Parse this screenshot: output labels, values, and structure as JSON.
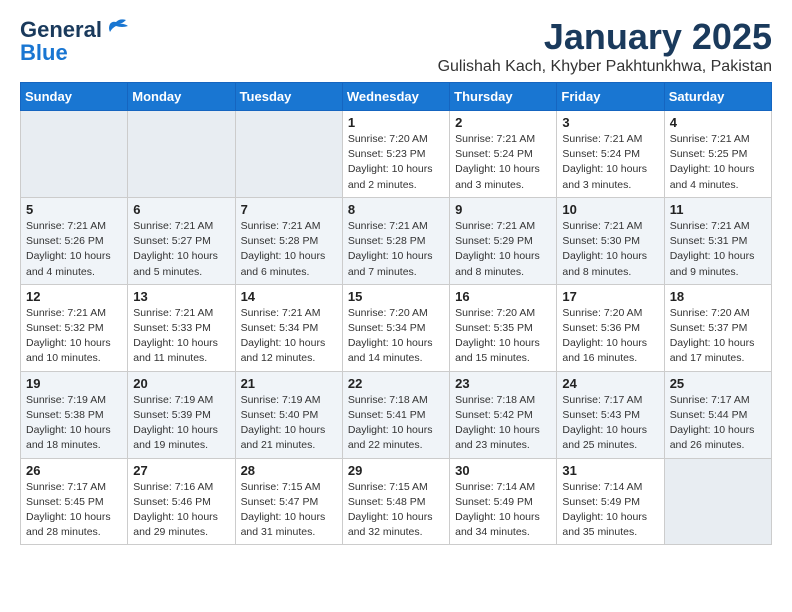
{
  "header": {
    "logo_line1": "General",
    "logo_line2": "Blue",
    "main_title": "January 2025",
    "subtitle": "Gulishah Kach, Khyber Pakhtunkhwa, Pakistan"
  },
  "calendar": {
    "days_of_week": [
      "Sunday",
      "Monday",
      "Tuesday",
      "Wednesday",
      "Thursday",
      "Friday",
      "Saturday"
    ],
    "weeks": [
      [
        {
          "day": "",
          "info": ""
        },
        {
          "day": "",
          "info": ""
        },
        {
          "day": "",
          "info": ""
        },
        {
          "day": "1",
          "info": "Sunrise: 7:20 AM\nSunset: 5:23 PM\nDaylight: 10 hours\nand 2 minutes."
        },
        {
          "day": "2",
          "info": "Sunrise: 7:21 AM\nSunset: 5:24 PM\nDaylight: 10 hours\nand 3 minutes."
        },
        {
          "day": "3",
          "info": "Sunrise: 7:21 AM\nSunset: 5:24 PM\nDaylight: 10 hours\nand 3 minutes."
        },
        {
          "day": "4",
          "info": "Sunrise: 7:21 AM\nSunset: 5:25 PM\nDaylight: 10 hours\nand 4 minutes."
        }
      ],
      [
        {
          "day": "5",
          "info": "Sunrise: 7:21 AM\nSunset: 5:26 PM\nDaylight: 10 hours\nand 4 minutes."
        },
        {
          "day": "6",
          "info": "Sunrise: 7:21 AM\nSunset: 5:27 PM\nDaylight: 10 hours\nand 5 minutes."
        },
        {
          "day": "7",
          "info": "Sunrise: 7:21 AM\nSunset: 5:28 PM\nDaylight: 10 hours\nand 6 minutes."
        },
        {
          "day": "8",
          "info": "Sunrise: 7:21 AM\nSunset: 5:28 PM\nDaylight: 10 hours\nand 7 minutes."
        },
        {
          "day": "9",
          "info": "Sunrise: 7:21 AM\nSunset: 5:29 PM\nDaylight: 10 hours\nand 8 minutes."
        },
        {
          "day": "10",
          "info": "Sunrise: 7:21 AM\nSunset: 5:30 PM\nDaylight: 10 hours\nand 8 minutes."
        },
        {
          "day": "11",
          "info": "Sunrise: 7:21 AM\nSunset: 5:31 PM\nDaylight: 10 hours\nand 9 minutes."
        }
      ],
      [
        {
          "day": "12",
          "info": "Sunrise: 7:21 AM\nSunset: 5:32 PM\nDaylight: 10 hours\nand 10 minutes."
        },
        {
          "day": "13",
          "info": "Sunrise: 7:21 AM\nSunset: 5:33 PM\nDaylight: 10 hours\nand 11 minutes."
        },
        {
          "day": "14",
          "info": "Sunrise: 7:21 AM\nSunset: 5:34 PM\nDaylight: 10 hours\nand 12 minutes."
        },
        {
          "day": "15",
          "info": "Sunrise: 7:20 AM\nSunset: 5:34 PM\nDaylight: 10 hours\nand 14 minutes."
        },
        {
          "day": "16",
          "info": "Sunrise: 7:20 AM\nSunset: 5:35 PM\nDaylight: 10 hours\nand 15 minutes."
        },
        {
          "day": "17",
          "info": "Sunrise: 7:20 AM\nSunset: 5:36 PM\nDaylight: 10 hours\nand 16 minutes."
        },
        {
          "day": "18",
          "info": "Sunrise: 7:20 AM\nSunset: 5:37 PM\nDaylight: 10 hours\nand 17 minutes."
        }
      ],
      [
        {
          "day": "19",
          "info": "Sunrise: 7:19 AM\nSunset: 5:38 PM\nDaylight: 10 hours\nand 18 minutes."
        },
        {
          "day": "20",
          "info": "Sunrise: 7:19 AM\nSunset: 5:39 PM\nDaylight: 10 hours\nand 19 minutes."
        },
        {
          "day": "21",
          "info": "Sunrise: 7:19 AM\nSunset: 5:40 PM\nDaylight: 10 hours\nand 21 minutes."
        },
        {
          "day": "22",
          "info": "Sunrise: 7:18 AM\nSunset: 5:41 PM\nDaylight: 10 hours\nand 22 minutes."
        },
        {
          "day": "23",
          "info": "Sunrise: 7:18 AM\nSunset: 5:42 PM\nDaylight: 10 hours\nand 23 minutes."
        },
        {
          "day": "24",
          "info": "Sunrise: 7:17 AM\nSunset: 5:43 PM\nDaylight: 10 hours\nand 25 minutes."
        },
        {
          "day": "25",
          "info": "Sunrise: 7:17 AM\nSunset: 5:44 PM\nDaylight: 10 hours\nand 26 minutes."
        }
      ],
      [
        {
          "day": "26",
          "info": "Sunrise: 7:17 AM\nSunset: 5:45 PM\nDaylight: 10 hours\nand 28 minutes."
        },
        {
          "day": "27",
          "info": "Sunrise: 7:16 AM\nSunset: 5:46 PM\nDaylight: 10 hours\nand 29 minutes."
        },
        {
          "day": "28",
          "info": "Sunrise: 7:15 AM\nSunset: 5:47 PM\nDaylight: 10 hours\nand 31 minutes."
        },
        {
          "day": "29",
          "info": "Sunrise: 7:15 AM\nSunset: 5:48 PM\nDaylight: 10 hours\nand 32 minutes."
        },
        {
          "day": "30",
          "info": "Sunrise: 7:14 AM\nSunset: 5:49 PM\nDaylight: 10 hours\nand 34 minutes."
        },
        {
          "day": "31",
          "info": "Sunrise: 7:14 AM\nSunset: 5:49 PM\nDaylight: 10 hours\nand 35 minutes."
        },
        {
          "day": "",
          "info": ""
        }
      ]
    ]
  }
}
